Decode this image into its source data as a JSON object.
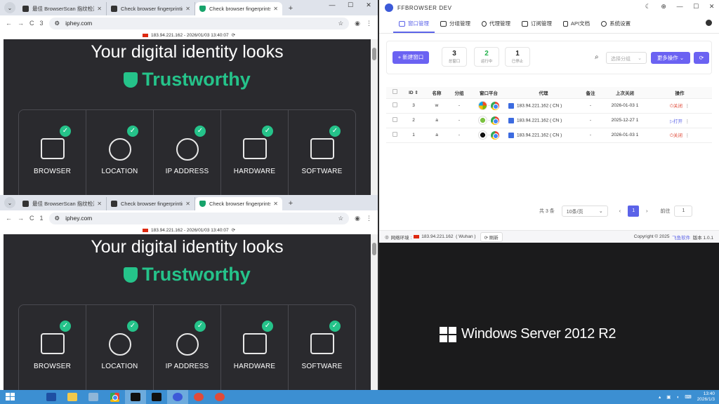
{
  "browser_top": {
    "tabs": [
      {
        "title": "最佳 BrowserScan 指纹检测工"
      },
      {
        "title": "Check browser fingerprinting"
      },
      {
        "title": "Check browser fingerprints"
      }
    ],
    "url": "iphey.com",
    "tab_count_badge": "3",
    "ip_info": "183.94.221.162 - 2026/01/03 13:40:07"
  },
  "browser_bottom": {
    "tabs": [
      {
        "title": "最佳 BrowserScan 指纹检测工"
      },
      {
        "title": "Check browser fingerprinting"
      },
      {
        "title": "Check browser fingerprints"
      }
    ],
    "url": "iphey.com",
    "tab_count_badge": "1",
    "ip_info": "183.94.221.162 - 2026/01/03 13:40:07"
  },
  "iphey": {
    "headline": "Your digital identity looks",
    "verdict": "Trustworthy",
    "cards": [
      {
        "label": "BROWSER"
      },
      {
        "label": "LOCATION"
      },
      {
        "label": "IP ADDRESS"
      },
      {
        "label": "HARDWARE"
      },
      {
        "label": "SOFTWARE"
      }
    ]
  },
  "ffbrowser": {
    "app_title": "FFBROWSER DEV",
    "nav": [
      {
        "label": "窗口管理"
      },
      {
        "label": "分组管理"
      },
      {
        "label": "代理管理"
      },
      {
        "label": "订阅管理"
      },
      {
        "label": "API文档"
      },
      {
        "label": "系统设置"
      }
    ],
    "new_window_label": "+ 新建窗口",
    "stats": [
      {
        "value": "3",
        "label": "总窗口"
      },
      {
        "value": "2",
        "label": "运行中"
      },
      {
        "value": "1",
        "label": "已停止"
      }
    ],
    "group_select_placeholder": "选择分组",
    "more_actions_label": "更多操作",
    "table": {
      "headers": [
        "ID",
        "名称",
        "分组",
        "窗口平台",
        "代理",
        "备注",
        "上次关闭",
        "操作"
      ],
      "rows": [
        {
          "id": "3",
          "name": "w",
          "group": "-",
          "proxy": "183.94.221.162 ( CN )",
          "note": "-",
          "last_closed": "2026-01-03 1",
          "action": "关闭"
        },
        {
          "id": "2",
          "name": "a",
          "group": "-",
          "proxy": "183.94.221.162 ( CN )",
          "note": "-",
          "last_closed": "2025-12-27 1",
          "action": "打开"
        },
        {
          "id": "1",
          "name": "a",
          "group": "-",
          "proxy": "183.94.221.162 ( CN )",
          "note": "-",
          "last_closed": "2026-01-03 1",
          "action": "关闭"
        }
      ]
    },
    "pager": {
      "total": "共 3 条",
      "page_size": "10条/页",
      "current_page": "1",
      "goto_label": "前往",
      "goto_value": "1"
    },
    "status": {
      "network_label": "网络环境 :",
      "ip": "183.94.221.162",
      "city": "( Wuhan )",
      "refresh_label": "刷新",
      "copyright": "Copyright © 2025",
      "vendor": "飞鱼软件",
      "version": "版本 1.0.1"
    }
  },
  "desktop": {
    "os_name": "Windows Server 2012 R2"
  },
  "taskbar": {
    "time": "13:40",
    "date": "2026/1/3"
  },
  "colors": {
    "accent": "#5b63e8",
    "trust_green": "#25c38a",
    "taskbar": "#3c8fd2"
  }
}
